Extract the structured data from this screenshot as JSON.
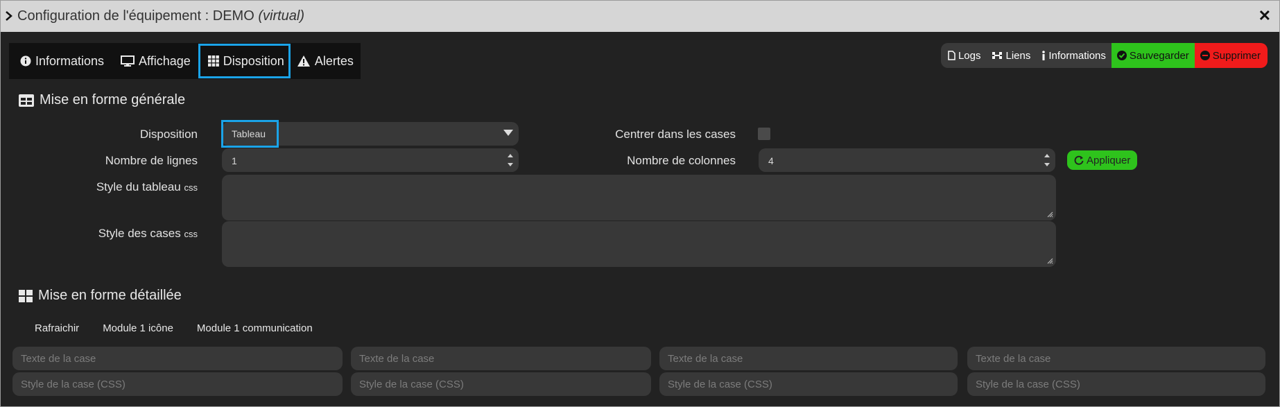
{
  "window": {
    "title_main": "Configuration de l'équipement : DEMO",
    "title_type": "(virtual)"
  },
  "tabs": [
    {
      "label": "Informations",
      "icon": "info-circle-icon"
    },
    {
      "label": "Affichage",
      "icon": "monitor-icon"
    },
    {
      "label": "Disposition",
      "icon": "grid-icon",
      "active": true
    },
    {
      "label": "Alertes",
      "icon": "warning-icon"
    }
  ],
  "actions": {
    "logs": "Logs",
    "liens": "Liens",
    "informations": "Informations",
    "save": "Sauvegarder",
    "delete": "Supprimer"
  },
  "general": {
    "title": "Mise en forme générale",
    "disposition_label": "Disposition",
    "disposition_value": "Tableau",
    "centrer_label": "Centrer dans les cases",
    "centrer_checked": false,
    "lignes_label": "Nombre de lignes",
    "lignes_value": "1",
    "colonnes_label": "Nombre de colonnes",
    "colonnes_value": "4",
    "apply_label": "Appliquer",
    "style_tableau_label": "Style du tableau",
    "style_cases_label": "Style des cases",
    "css_suffix": "css"
  },
  "detail": {
    "title": "Mise en forme détaillée",
    "modules": [
      "Rafraichir",
      "Module 1 icône",
      "Module 1 communication"
    ],
    "text_placeholder": "Texte de la case",
    "style_placeholder": "Style de la case (CSS)"
  },
  "colors": {
    "accent_highlight": "#1aa3e8",
    "save_green": "#2ec31c",
    "delete_red": "#f01b1b",
    "background": "#222222"
  }
}
